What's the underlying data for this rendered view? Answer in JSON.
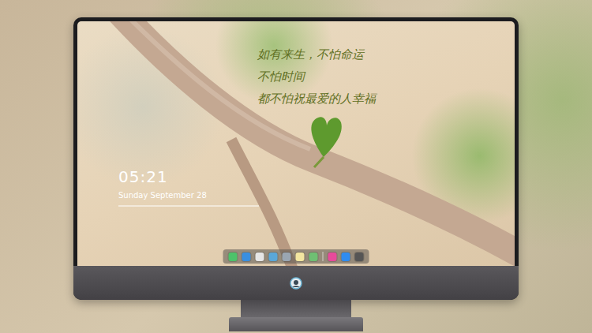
{
  "desktop": {
    "wallpaper_caption": [
      "如有来生，不怕命运",
      "不怕时间",
      "都不怕祝最爱的人幸福"
    ],
    "clock": {
      "time": "05:21",
      "date": "Sunday September 28"
    }
  },
  "dock": {
    "groups": [
      [
        {
          "color": "#4cc26a"
        },
        {
          "color": "#3a8fe0"
        },
        {
          "color": "#e6e6e6"
        },
        {
          "color": "#5aa7d8"
        },
        {
          "color": "#9aa6b2"
        },
        {
          "color": "#f3e6a0"
        },
        {
          "color": "#6fbf73"
        }
      ],
      [
        {
          "color": "#e84a9b"
        },
        {
          "color": "#2f8cf0"
        },
        {
          "color": "#555555"
        }
      ]
    ]
  }
}
